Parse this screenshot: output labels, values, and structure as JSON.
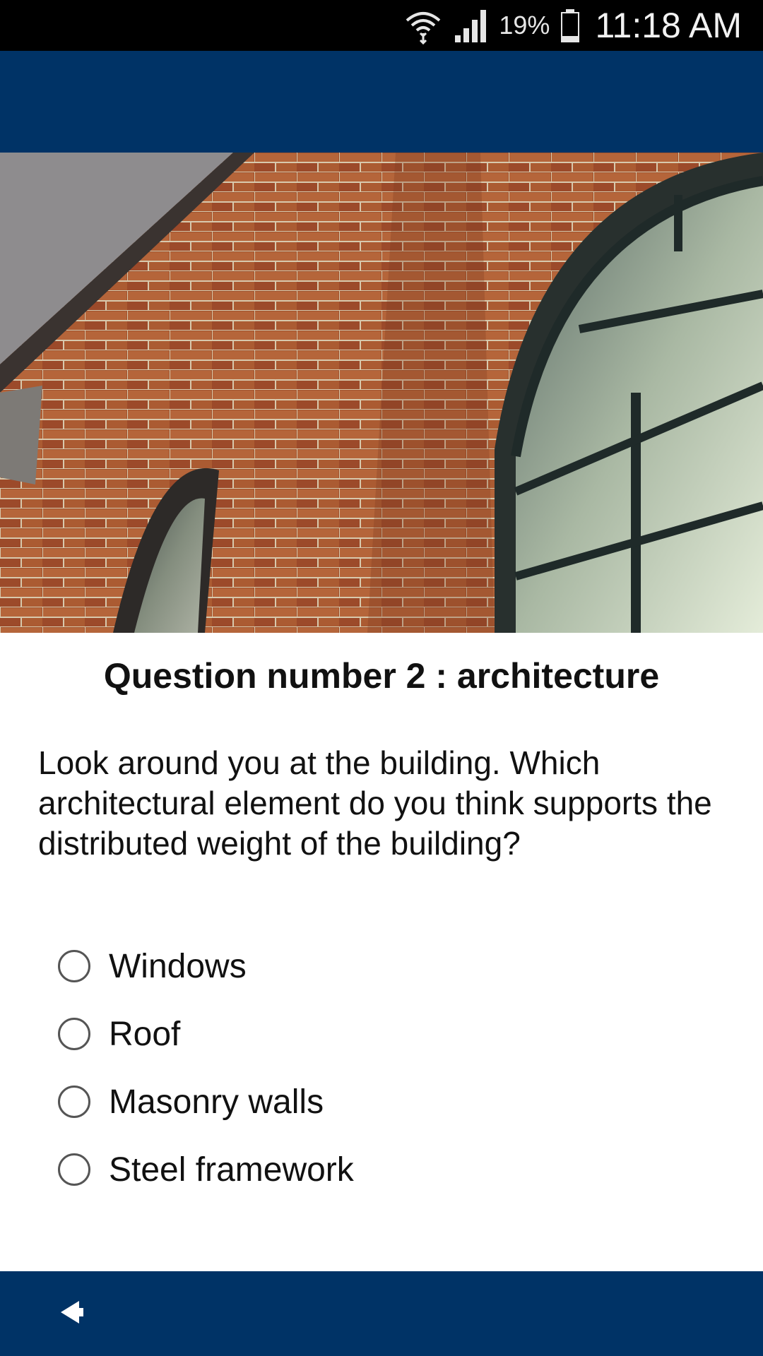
{
  "status_bar": {
    "battery_percent": "19%",
    "time": "11:18 AM",
    "icons": [
      "wifi-icon",
      "signal-icon",
      "battery-icon"
    ]
  },
  "colors": {
    "app_bar": "#003366",
    "bottom_bar": "#003366",
    "status_bar": "#000000"
  },
  "hero_image": {
    "zoom_icon": "magnifier-icon"
  },
  "question": {
    "title": "Question number 2 : architecture",
    "text": "Look around you at the building. Which architectural element do you think supports the distributed weight of the building?"
  },
  "options": [
    {
      "label": "Windows",
      "selected": false
    },
    {
      "label": "Roof",
      "selected": false
    },
    {
      "label": "Masonry walls",
      "selected": false
    },
    {
      "label": "Steel framework",
      "selected": false
    }
  ],
  "navigation": {
    "back_icon": "back-arrow-icon"
  }
}
